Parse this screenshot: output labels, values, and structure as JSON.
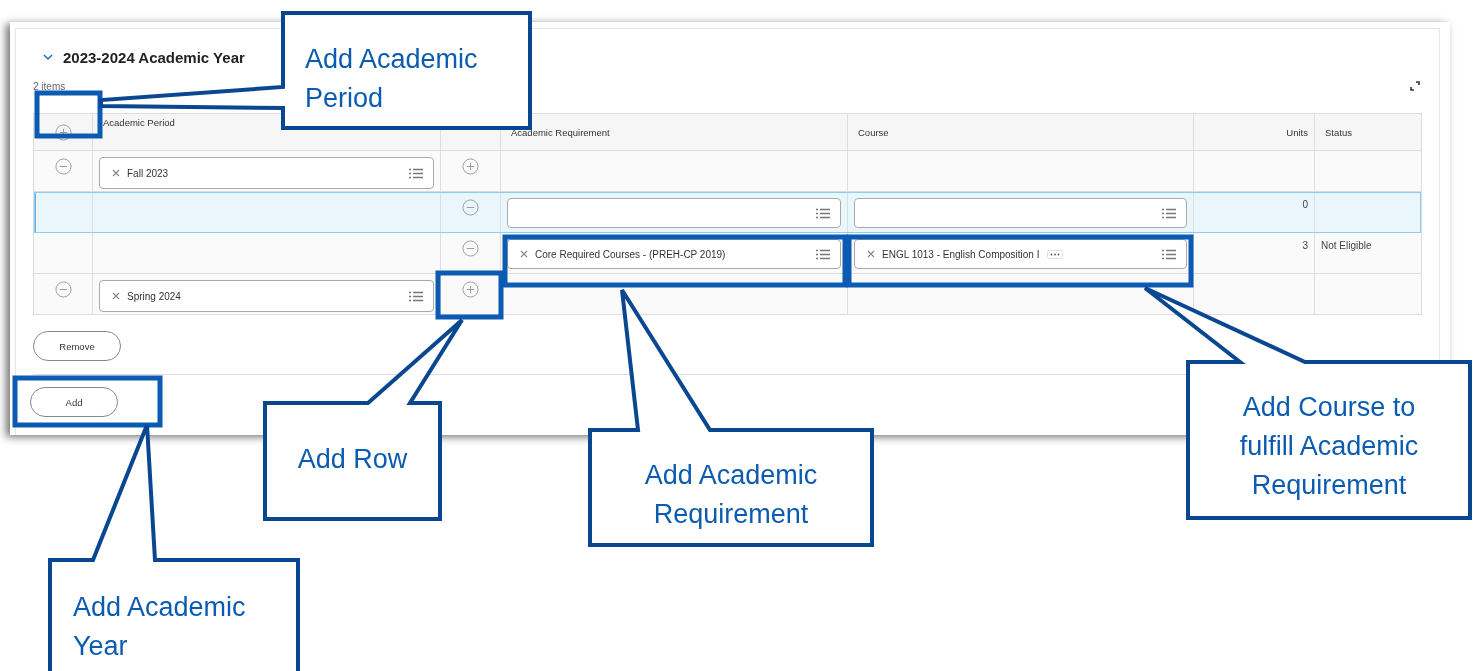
{
  "section": {
    "title": "2023-2024 Academic Year",
    "expanded": true,
    "count": "2 items"
  },
  "table": {
    "columns": [
      "Academic Period",
      "Academic Requirement",
      "Course",
      "Units",
      "Status"
    ],
    "rows": [
      {
        "kind": "period",
        "selected": false,
        "period": "Fall 2023"
      },
      {
        "kind": "requirement",
        "selected": true,
        "units": "0"
      },
      {
        "kind": "requirement",
        "selected": false,
        "requirement": "Core Required Courses - (PREH-CP 2019)",
        "course": "ENGL 1013 - English Composition I",
        "units": "3",
        "status": "Not Eligible"
      },
      {
        "kind": "period",
        "selected": false,
        "period": "Spring 2024"
      }
    ]
  },
  "buttons": [
    "Remove",
    "Add"
  ],
  "callouts": [
    {
      "text": "Add Academic Period"
    },
    {
      "text": "Add Row"
    },
    {
      "text": "Add Academic Year"
    },
    {
      "text": "Add Academic Requirement"
    },
    {
      "text": "Add Course to fulfill Academic Requirement"
    }
  ]
}
